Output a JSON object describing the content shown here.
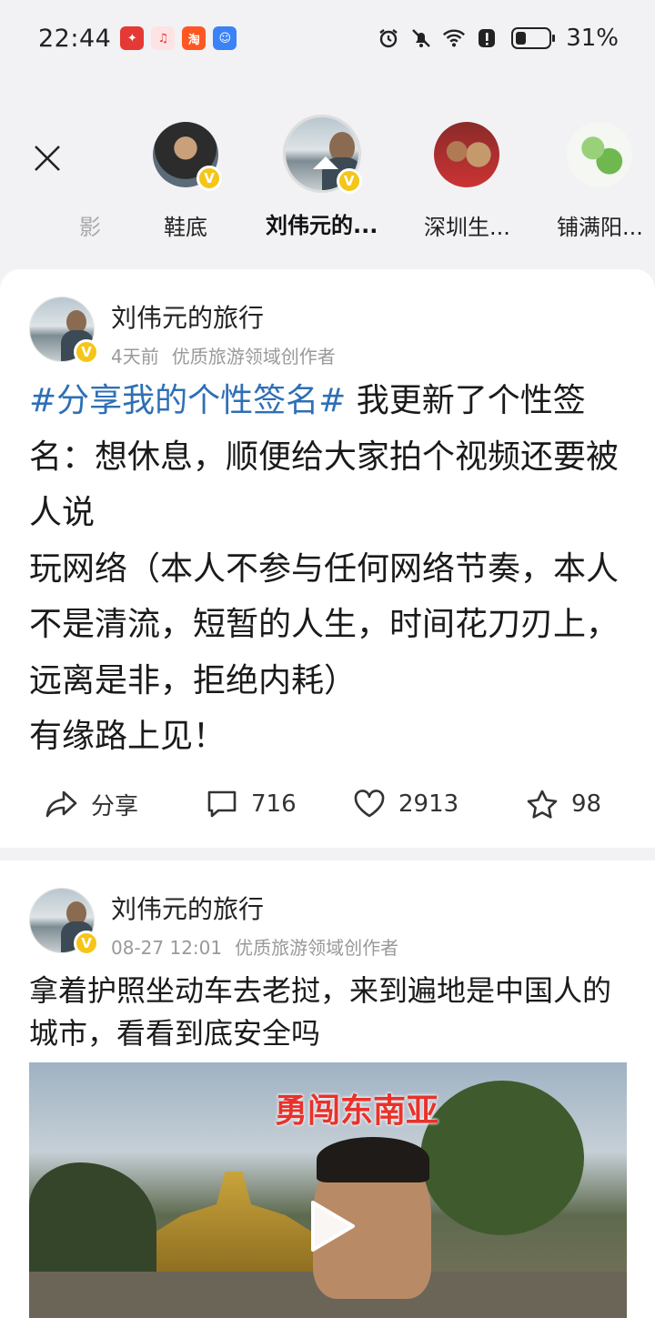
{
  "status_bar": {
    "time": "22:44",
    "battery_percent": "31%",
    "battery_level": 0.31
  },
  "stories": {
    "items": [
      {
        "label": "影"
      },
      {
        "label": "鞋底"
      },
      {
        "label": "刘伟元的..."
      },
      {
        "label": "深圳生..."
      },
      {
        "label": "铺满阳..."
      }
    ]
  },
  "posts": [
    {
      "author": "刘伟元的旅行",
      "time": "4天前",
      "tag": "优质旅游领域创作者",
      "hashtag": "#分享我的个性签名#",
      "text": " 我更新了个性签名：想休息，顺便给大家拍个视频还要被人说\n玩网络（本人不参与任何网络节奏，本人不是清流，短暂的人生，时间花刀刃上，远离是非，拒绝内耗）\n有缘路上见！",
      "share_label": "分享",
      "comments": "716",
      "likes": "2913",
      "favorites": "98"
    },
    {
      "author": "刘伟元的旅行",
      "time": "08-27 12:01",
      "tag": "优质旅游领域创作者",
      "text": "拿着护照坐动车去老挝，来到遍地是中国人的城市，看看到底安全吗",
      "video_title": "勇闯东南亚"
    }
  ],
  "colors": {
    "hashtag": "#2f6fb5",
    "verified_badge": "#f5c518",
    "video_title": "#e8322b"
  }
}
